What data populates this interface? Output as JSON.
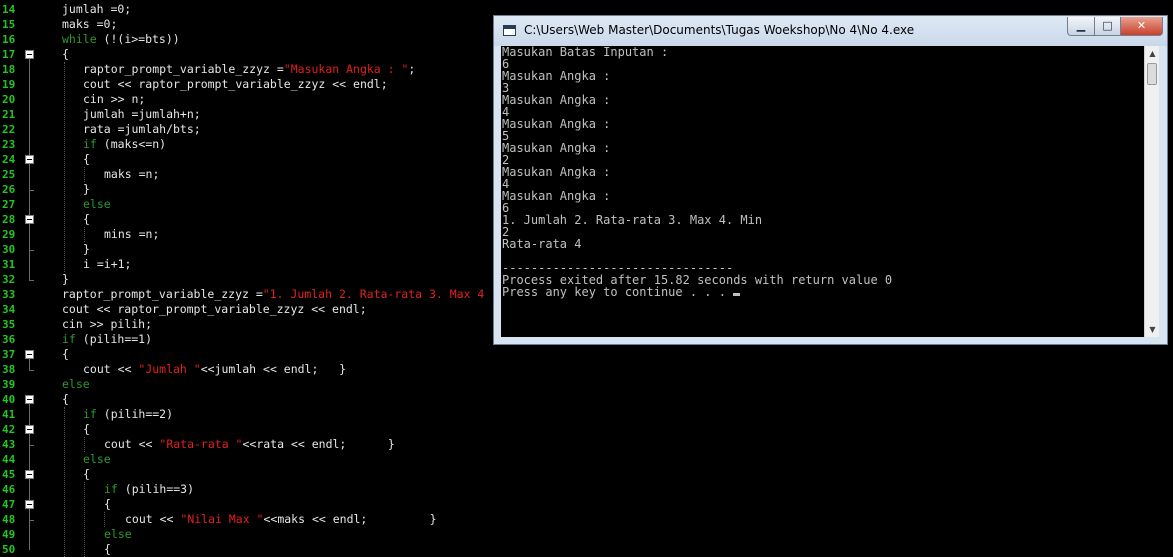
{
  "editor": {
    "colors": {
      "line_number": "#22c522",
      "keyword": "#2a9a2a",
      "string": "#e02020",
      "text": "#e6e6e6",
      "background": "#000000"
    },
    "lines": [
      {
        "n": "14",
        "parts": [
          [
            "t",
            "jumlah =0;"
          ]
        ],
        "indent": 0
      },
      {
        "n": "15",
        "parts": [
          [
            "t",
            "maks =0;"
          ]
        ],
        "indent": 0
      },
      {
        "n": "16",
        "parts": [
          [
            "k",
            "while"
          ],
          [
            "t",
            " (!(i>=bts))"
          ]
        ],
        "indent": 0
      },
      {
        "n": "17",
        "parts": [
          [
            "t",
            "{"
          ]
        ],
        "indent": 0
      },
      {
        "n": "18",
        "parts": [
          [
            "t",
            "raptor_prompt_variable_zzyz ="
          ],
          [
            "s",
            "\"Masukan Angka : \""
          ],
          [
            "t",
            ";"
          ]
        ],
        "indent": 1
      },
      {
        "n": "19",
        "parts": [
          [
            "t",
            "cout << raptor_prompt_variable_zzyz << endl;"
          ]
        ],
        "indent": 1
      },
      {
        "n": "20",
        "parts": [
          [
            "t",
            "cin >> n;"
          ]
        ],
        "indent": 1
      },
      {
        "n": "21",
        "parts": [
          [
            "t",
            "jumlah =jumlah+n;"
          ]
        ],
        "indent": 1
      },
      {
        "n": "22",
        "parts": [
          [
            "t",
            "rata =jumlah/bts;"
          ]
        ],
        "indent": 1
      },
      {
        "n": "23",
        "parts": [
          [
            "k",
            "if"
          ],
          [
            "t",
            " (maks<=n)"
          ]
        ],
        "indent": 1
      },
      {
        "n": "24",
        "parts": [
          [
            "t",
            "{"
          ]
        ],
        "indent": 1
      },
      {
        "n": "25",
        "parts": [
          [
            "t",
            "maks =n;"
          ]
        ],
        "indent": 2
      },
      {
        "n": "26",
        "parts": [
          [
            "t",
            "}"
          ]
        ],
        "indent": 1
      },
      {
        "n": "27",
        "parts": [
          [
            "k",
            "else"
          ]
        ],
        "indent": 1
      },
      {
        "n": "28",
        "parts": [
          [
            "t",
            "{"
          ]
        ],
        "indent": 1
      },
      {
        "n": "29",
        "parts": [
          [
            "t",
            "mins =n;"
          ]
        ],
        "indent": 2
      },
      {
        "n": "30",
        "parts": [
          [
            "t",
            "}"
          ]
        ],
        "indent": 1
      },
      {
        "n": "31",
        "parts": [
          [
            "t",
            "i =i+1;"
          ]
        ],
        "indent": 1
      },
      {
        "n": "32",
        "parts": [
          [
            "t",
            "}"
          ]
        ],
        "indent": 0
      },
      {
        "n": "33",
        "parts": [
          [
            "t",
            "raptor_prompt_variable_zzyz ="
          ],
          [
            "s",
            "\"1. Jumlah 2. Rata-rata 3. Max 4"
          ]
        ],
        "indent": 0
      },
      {
        "n": "34",
        "parts": [
          [
            "t",
            "cout << raptor_prompt_variable_zzyz << endl;"
          ]
        ],
        "indent": 0
      },
      {
        "n": "35",
        "parts": [
          [
            "t",
            "cin >> pilih;"
          ]
        ],
        "indent": 0
      },
      {
        "n": "36",
        "parts": [
          [
            "k",
            "if"
          ],
          [
            "t",
            " (pilih==1)"
          ]
        ],
        "indent": 0
      },
      {
        "n": "37",
        "parts": [
          [
            "t",
            "{"
          ]
        ],
        "indent": 0
      },
      {
        "n": "38",
        "parts": [
          [
            "t",
            "cout << "
          ],
          [
            "s",
            "\"Jumlah \""
          ],
          [
            "t",
            "<<jumlah << endl;   }"
          ]
        ],
        "indent": 1
      },
      {
        "n": "39",
        "parts": [
          [
            "k",
            "else"
          ]
        ],
        "indent": 0
      },
      {
        "n": "40",
        "parts": [
          [
            "t",
            "{"
          ]
        ],
        "indent": 0
      },
      {
        "n": "41",
        "parts": [
          [
            "k",
            "if"
          ],
          [
            "t",
            " (pilih==2)"
          ]
        ],
        "indent": 1
      },
      {
        "n": "42",
        "parts": [
          [
            "t",
            "{"
          ]
        ],
        "indent": 1
      },
      {
        "n": "43",
        "parts": [
          [
            "t",
            "cout << "
          ],
          [
            "s",
            "\"Rata-rata \""
          ],
          [
            "t",
            "<<rata << endl;      }"
          ]
        ],
        "indent": 2
      },
      {
        "n": "44",
        "parts": [
          [
            "k",
            "else"
          ]
        ],
        "indent": 1
      },
      {
        "n": "45",
        "parts": [
          [
            "t",
            "{"
          ]
        ],
        "indent": 1
      },
      {
        "n": "46",
        "parts": [
          [
            "k",
            "if"
          ],
          [
            "t",
            " (pilih==3)"
          ]
        ],
        "indent": 2
      },
      {
        "n": "47",
        "parts": [
          [
            "t",
            "{"
          ]
        ],
        "indent": 2
      },
      {
        "n": "48",
        "parts": [
          [
            "t",
            "cout << "
          ],
          [
            "s",
            "\"Nilai Max \""
          ],
          [
            "t",
            "<<maks << endl;         }"
          ]
        ],
        "indent": 3
      },
      {
        "n": "49",
        "parts": [
          [
            "k",
            "else"
          ]
        ],
        "indent": 2
      },
      {
        "n": "50",
        "parts": [
          [
            "t",
            "{"
          ]
        ],
        "indent": 2
      }
    ]
  },
  "console": {
    "title": "C:\\Users\\Web Master\\Documents\\Tugas Woekshop\\No 4\\No 4.exe",
    "buttons": {
      "minimize": "▁",
      "maximize": "□",
      "close": "✕"
    },
    "output": "Masukan Batas Inputan :\n6\nMasukan Angka :\n3\nMasukan Angka :\n4\nMasukan Angka :\n5\nMasukan Angka :\n2\nMasukan Angka :\n4\nMasukan Angka :\n6\n1. Jumlah 2. Rata-rata 3. Max 4. Min\n2\nRata-rata 4\n\n--------------------------------\nProcess exited after 15.82 seconds with return value 0\nPress any key to continue . . . ",
    "scroll_up": "▲",
    "scroll_down": "▼"
  }
}
